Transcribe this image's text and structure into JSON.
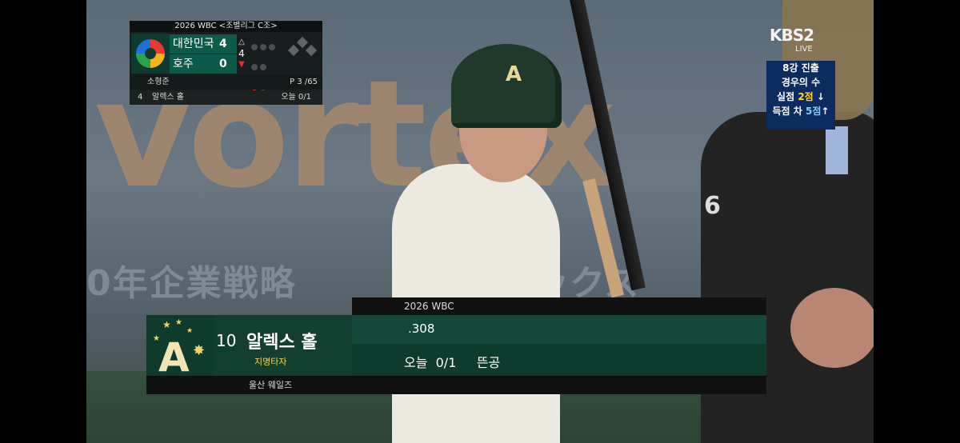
{
  "broadcast": {
    "channel": "KBS2",
    "live": "LIVE"
  },
  "scoreboard": {
    "title": "2026 WBC <조별리그 C조>",
    "teams": [
      {
        "name": "대한민국",
        "score": "4"
      },
      {
        "name": "호주",
        "score": "0"
      }
    ],
    "inning": "4",
    "pitcher": {
      "name": "소형준",
      "pitch_count": "P  3 /65"
    },
    "batter": {
      "order": "4",
      "name": "알렉스 홀",
      "today": "오늘 0/1"
    }
  },
  "side_panel": {
    "line1": "8강 진출",
    "line2": "경우의 수",
    "line3a": "실점",
    "line3b": "2점",
    "line3c": "↓",
    "line4a": "득점 차",
    "line4b": "5점",
    "line4c": "↑"
  },
  "lower_third": {
    "header": "2026 WBC",
    "number": "10",
    "name": "알렉스 홀",
    "position": "지명타자",
    "average": ".308",
    "today_label": "오늘",
    "today_value": "0/1",
    "last_result": "뜬공",
    "team": "울산 웨일즈"
  },
  "background_ad": {
    "brand": "vortex",
    "jp_text": "0年企業戦略",
    "jp_text2": "ックス"
  },
  "colors": {
    "team_green": "#133f31",
    "accent_yellow": "#ffd43b",
    "out_red": "#e53030"
  }
}
